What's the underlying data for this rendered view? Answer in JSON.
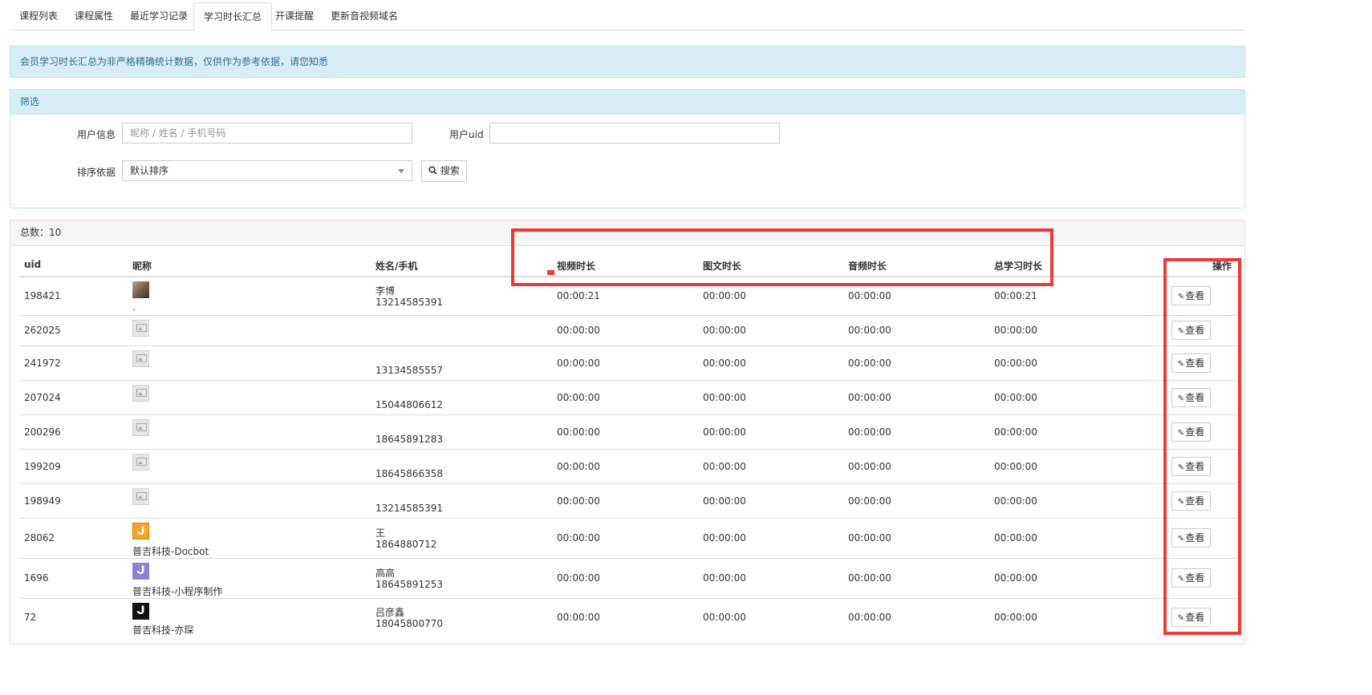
{
  "tabs": [
    {
      "label": "课程列表"
    },
    {
      "label": "课程属性"
    },
    {
      "label": "最近学习记录"
    },
    {
      "label": "学习时长汇总"
    },
    {
      "label": "开课提醒"
    },
    {
      "label": "更新音视频域名"
    }
  ],
  "alert": {
    "text": "会员学习时长汇总为非严格精确统计数据，仅供作为参考依据，请您知悉"
  },
  "filter": {
    "title": "筛选",
    "user_info_label": "用户信息",
    "user_info_placeholder": "昵称 / 姓名 / 手机号码",
    "uid_label": "用户uid",
    "uid_value": "",
    "sort_label": "排序依据",
    "sort_value": "默认排序",
    "search_label": "搜索"
  },
  "table": {
    "total_text": "总数：10",
    "headers": [
      "uid",
      "昵称",
      "姓名/手机",
      "视频时长",
      "图文时长",
      "音频时长",
      "总学习时长",
      "操作"
    ],
    "view_label": "查看",
    "rows": [
      {
        "uid": "198421",
        "avatar": "photo",
        "nickname": ".",
        "name": "李博",
        "phone": "13214585391",
        "video": "00:00:21",
        "text": "00:00:00",
        "audio": "00:00:00",
        "total": "00:00:21"
      },
      {
        "uid": "262025",
        "avatar": "placeholder",
        "nickname": "",
        "name": "",
        "phone": "",
        "video": "00:00:00",
        "text": "00:00:00",
        "audio": "00:00:00",
        "total": "00:00:00"
      },
      {
        "uid": "241972",
        "avatar": "placeholder",
        "nickname": "",
        "name": "",
        "phone": "13134585557",
        "video": "00:00:00",
        "text": "00:00:00",
        "audio": "00:00:00",
        "total": "00:00:00"
      },
      {
        "uid": "207024",
        "avatar": "placeholder",
        "nickname": "",
        "name": "",
        "phone": "15044806612",
        "video": "00:00:00",
        "text": "00:00:00",
        "audio": "00:00:00",
        "total": "00:00:00"
      },
      {
        "uid": "200296",
        "avatar": "placeholder",
        "nickname": "",
        "name": "",
        "phone": "18645891283",
        "video": "00:00:00",
        "text": "00:00:00",
        "audio": "00:00:00",
        "total": "00:00:00"
      },
      {
        "uid": "199209",
        "avatar": "placeholder",
        "nickname": "",
        "name": "",
        "phone": "18645866358",
        "video": "00:00:00",
        "text": "00:00:00",
        "audio": "00:00:00",
        "total": "00:00:00"
      },
      {
        "uid": "198949",
        "avatar": "placeholder",
        "nickname": "",
        "name": "",
        "phone": "13214585391",
        "video": "00:00:00",
        "text": "00:00:00",
        "audio": "00:00:00",
        "total": "00:00:00"
      },
      {
        "uid": "28062",
        "avatar": "logo-orange",
        "nickname": "普吉科技-Docbot",
        "name": "王",
        "phone": "1864880712",
        "video": "00:00:00",
        "text": "00:00:00",
        "audio": "00:00:00",
        "total": "00:00:00"
      },
      {
        "uid": "1696",
        "avatar": "logo-purple",
        "nickname": "普吉科技-小程序制作",
        "name": "高高",
        "phone": "18645891253",
        "video": "00:00:00",
        "text": "00:00:00",
        "audio": "00:00:00",
        "total": "00:00:00"
      },
      {
        "uid": "72",
        "avatar": "logo-black",
        "nickname": "普吉科技-亦琛",
        "name": "吕彦鑫",
        "phone": "18045800770",
        "video": "00:00:00",
        "text": "00:00:00",
        "audio": "00:00:00",
        "total": "00:00:00"
      }
    ]
  },
  "colors": {
    "highlight": "#f03838",
    "info_bg": "#d9edf7",
    "info_text": "#31708f"
  },
  "icons": {
    "search": "search-icon",
    "view": "edit-icon"
  }
}
